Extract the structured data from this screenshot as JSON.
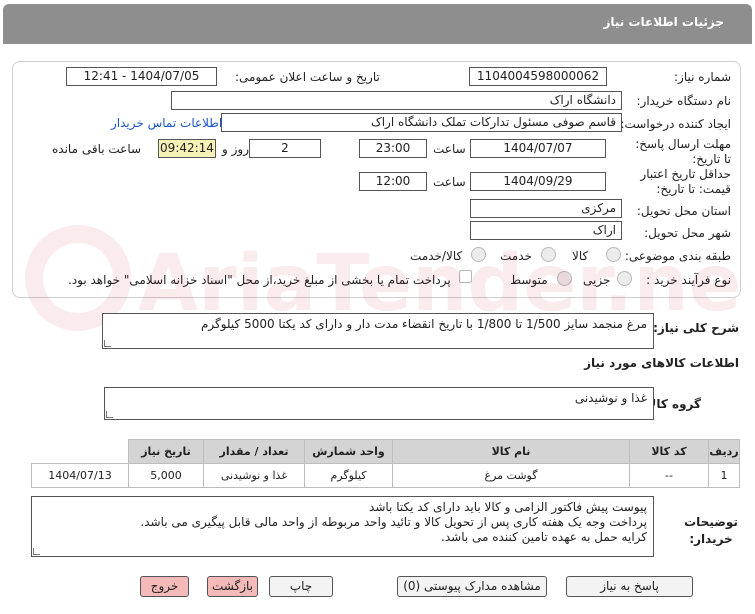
{
  "header": {
    "title": "جزئیات اطلاعات نیاز"
  },
  "form": {
    "need_number_label": "شماره نیاز:",
    "need_number": "1104004598000062",
    "announce_label": "تاریخ و ساعت اعلان عمومی:",
    "announce_value": "1404/07/05 - 12:41",
    "buyer_org_label": "نام دستگاه خریدار:",
    "buyer_org": "دانشگاه اراک",
    "creator_label": "ایجاد کننده درخواست:",
    "creator": "قاسم صوفی مسئول تدارکات تملک دانشگاه اراک",
    "contact_link": "اطلاعات تماس خریدار",
    "deadline_label": "مهلت ارسال پاسخ: تا تاریخ:",
    "deadline_date": "1404/07/07",
    "time_label": "ساعت",
    "deadline_time": "23:00",
    "days_value": "2",
    "days_label": "روز و",
    "remaining_time": "09:42:14",
    "remaining_label": "ساعت باقی مانده",
    "validity_label": "حداقل تاریخ اعتبار قیمت: تا تاریخ:",
    "validity_date": "1404/09/29",
    "validity_time": "12:00",
    "province_label": "استان محل تحویل:",
    "province": "مرکزی",
    "city_label": "شهر محل تحویل:",
    "city": "اراک",
    "category_label": "طبقه بندی موضوعی:",
    "category_options": [
      "کالا",
      "خدمت",
      "کالا/خدمت"
    ],
    "process_label": "نوع فرآیند خرید :",
    "process_options": [
      "جزیی",
      "متوسط"
    ],
    "payment_note": "پرداخت تمام یا بخشی از مبلغ خرید،از محل \"اسناد خزانه اسلامی\" خواهد بود."
  },
  "description": {
    "label": "شرح کلی نیاز:",
    "text": "مرغ منجمد سایز 1/500 تا 1/800 با تاریخ انقضاء مدت دار و دارای کد یکتا    5000  کیلوگرم"
  },
  "goods_info": {
    "title": "اطلاعات کالاهای مورد نیاز",
    "group_label": "گروه کالا:",
    "group_value": "غذا و نوشیدنی"
  },
  "table": {
    "headers": [
      "ردیف",
      "کد کالا",
      "نام کالا",
      "واحد شمارش",
      "تعداد / مقدار",
      "تاریخ نیاز"
    ],
    "rows": [
      [
        "1",
        "--",
        "گوشت مرغ",
        "کیلوگرم",
        "5,000",
        "1404/07/13"
      ]
    ],
    "unit_group": "غذا و نوشیدنی"
  },
  "notes": {
    "label": "توضیحات خریدار:",
    "lines": [
      "پیوست پیش فاکتور الزامی و کالا باید دارای کد یکتا باشد",
      "پرداخت وجه یک هفته کاری پس از تحویل کالا و تائید واحد مربوطه از واحد مالی قابل پیگیری می باشد.",
      "کرایه حمل به عهده تامین کننده می باشد."
    ]
  },
  "buttons": {
    "reply": "پاسخ به نیاز",
    "attachments": "مشاهده مدارک پیوستی (0)",
    "print": "چاپ",
    "back": "بازگشت",
    "exit": "خروج"
  },
  "watermark": {
    "text": "AriaTender.neT"
  }
}
